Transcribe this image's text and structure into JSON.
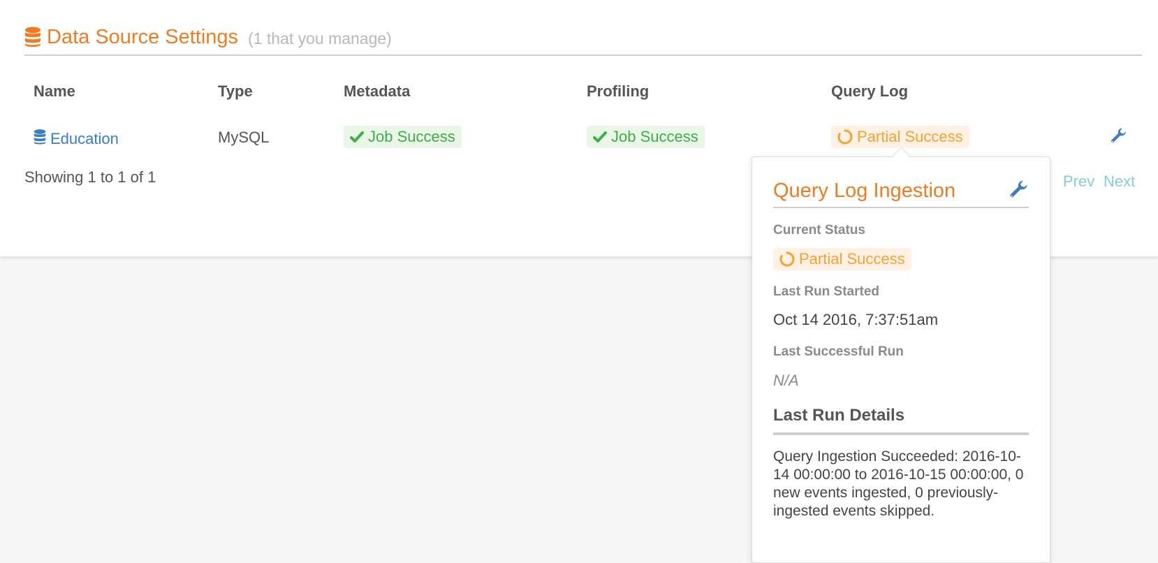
{
  "header": {
    "icon": "database-icon",
    "title": "Data Source Settings",
    "subtitle": "(1 that you manage)"
  },
  "table": {
    "columns": [
      "Name",
      "Type",
      "Metadata",
      "Profiling",
      "Query Log"
    ],
    "rows": [
      {
        "name": "Education",
        "name_icon": "database-icon",
        "type": "MySQL",
        "metadata": "Job Success",
        "profiling": "Job Success",
        "query_log": "Partial Success",
        "action_icon": "wrench-icon"
      }
    ]
  },
  "footer": {
    "showing": "Showing 1 to 1 of 1",
    "prev": "Prev",
    "next": "Next"
  },
  "popover": {
    "title": "Query Log Ingestion",
    "current_status_label": "Current Status",
    "current_status": "Partial Success",
    "last_run_started_label": "Last Run Started",
    "last_run_started": "Oct 14 2016, 7:37:51am",
    "last_successful_run_label": "Last Successful Run",
    "last_successful_run": "N/A",
    "details_heading": "Last Run Details",
    "details_text": "Query Ingestion Succeeded: 2016-10-14 00:00:00 to 2016-10-15 00:00:00, 0 new events ingested, 0 previously-ingested events skipped."
  },
  "colors": {
    "accent": "#f07b21",
    "link": "#3a7dc2",
    "success": "#3fae49",
    "partial": "#f5a233",
    "pager": "#85cfd4"
  }
}
